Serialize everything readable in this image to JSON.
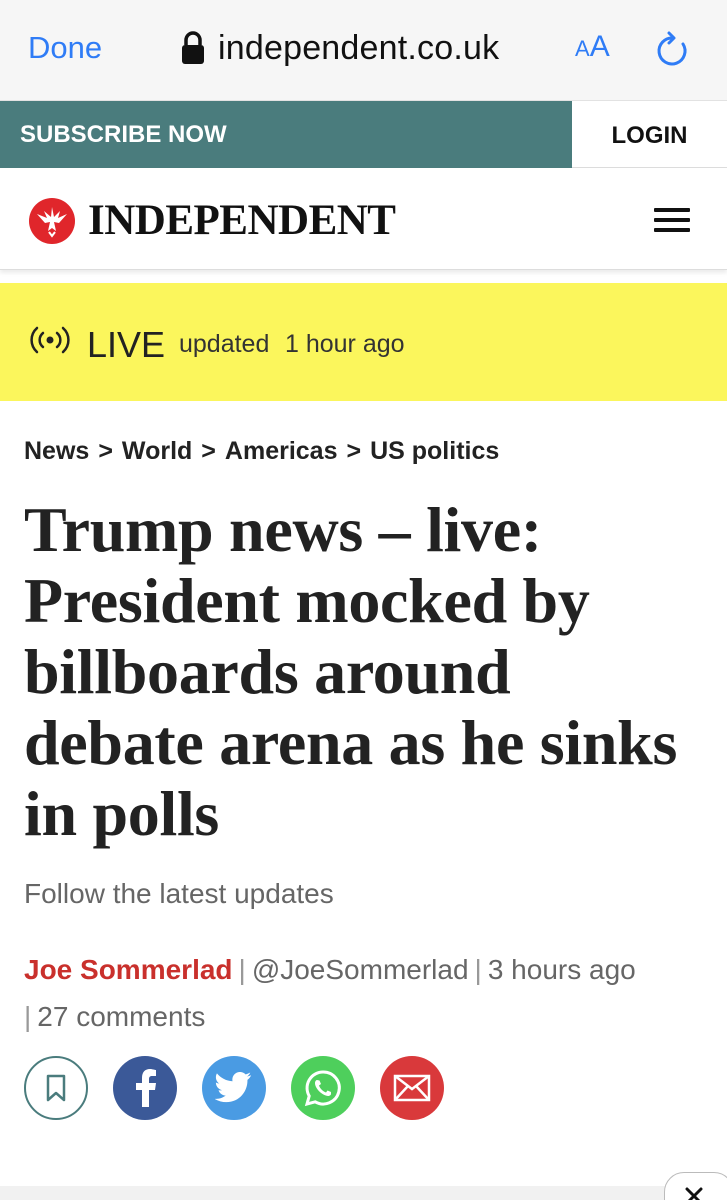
{
  "browser": {
    "done_label": "Done",
    "url": "independent.co.uk",
    "text_size_label_small": "A",
    "text_size_label_large": "A",
    "accent_color": "#2f7cf6"
  },
  "top_bar": {
    "subscribe_label": "SUBSCRIBE NOW",
    "login_label": "LOGIN",
    "subscribe_color": "#4a7c7d"
  },
  "masthead": {
    "brand": "INDEPENDENT",
    "logo_icon": "eagle-icon",
    "menu_icon": "hamburger-menu-icon"
  },
  "live_banner": {
    "label": "LIVE",
    "updated_label": "updated",
    "updated_time": "1 hour ago",
    "background_color": "#fbf65c"
  },
  "breadcrumb": {
    "items": [
      "News",
      "World",
      "Americas",
      "US politics"
    ],
    "separator": ">"
  },
  "article": {
    "headline": "Trump news – live: President mocked by billboards around debate arena as he sinks in polls",
    "standfirst": "Follow the latest updates",
    "author": "Joe Sommerlad",
    "handle": "@JoeSommerlad",
    "published": "3 hours ago",
    "comments": "27 comments",
    "author_color": "#c9302c"
  },
  "share": {
    "buttons": [
      "bookmark-icon",
      "facebook-icon",
      "twitter-icon",
      "whatsapp-icon",
      "email-icon"
    ]
  }
}
